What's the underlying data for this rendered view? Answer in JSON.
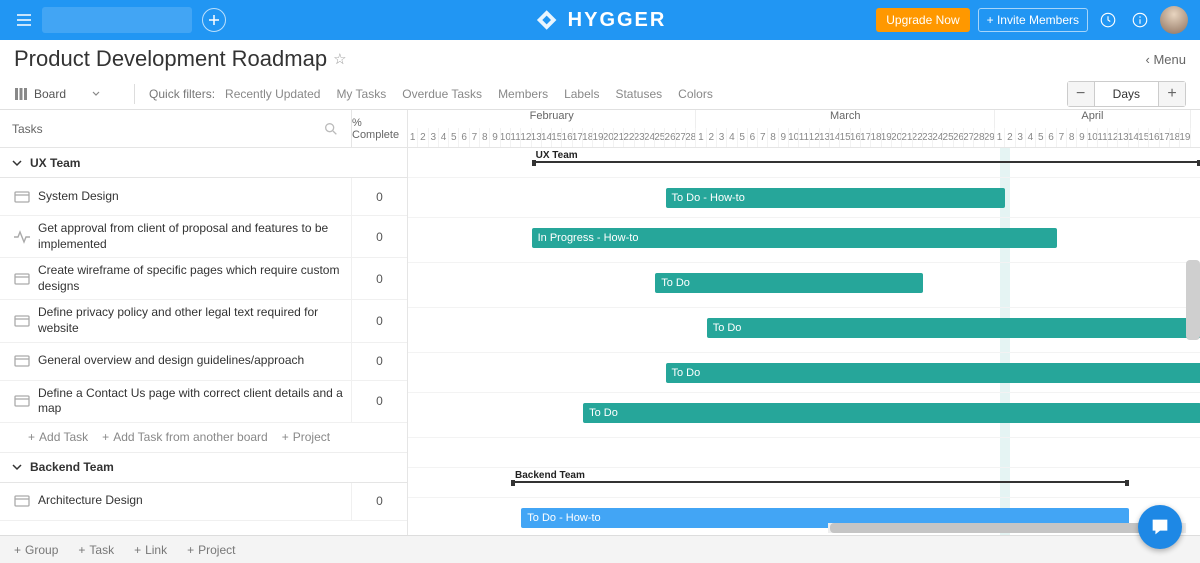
{
  "brand": "HYGGER",
  "header": {
    "upgrade": "Upgrade Now",
    "invite": "+ Invite Members"
  },
  "page": {
    "title": "Product Development Roadmap",
    "menu_link": "Menu"
  },
  "view": {
    "name": "Board"
  },
  "quick_filters_label": "Quick filters:",
  "quick_filters": [
    "Recently Updated",
    "My Tasks",
    "Overdue Tasks",
    "Members",
    "Labels",
    "Statuses",
    "Colors"
  ],
  "zoom": {
    "label": "Days"
  },
  "columns": {
    "tasks": "Tasks",
    "complete": "% Complete"
  },
  "groups": [
    {
      "name": "UX Team",
      "tasks": [
        {
          "name": "System Design",
          "complete": "0",
          "bar": {
            "label": "To Do - How-to",
            "color": "teal",
            "start": 25,
            "span": 33
          }
        },
        {
          "name": "Get approval from client of proposal and features to be implemented",
          "complete": "0",
          "activity": true,
          "bar": {
            "label": "In Progress - How-to",
            "color": "teal",
            "start": 12,
            "span": 51
          }
        },
        {
          "name": "Create wireframe of specific pages which require custom designs",
          "complete": "0",
          "bar": {
            "label": "To Do",
            "color": "teal",
            "start": 24,
            "span": 26
          }
        },
        {
          "name": "Define privacy policy and other legal text required for website",
          "complete": "0",
          "bar": {
            "label": "To Do",
            "color": "teal",
            "start": 29,
            "span": 50
          }
        },
        {
          "name": "General overview and design guidelines/approach",
          "complete": "0",
          "bar": {
            "label": "To Do",
            "color": "teal",
            "start": 25,
            "span": 54
          }
        },
        {
          "name": "Define a Contact Us page with correct client details and a map",
          "complete": "0",
          "bar": {
            "label": "To Do",
            "color": "teal",
            "start": 17,
            "span": 60
          }
        }
      ],
      "group_bar": {
        "start": 12,
        "span": 65
      }
    },
    {
      "name": "Backend Team",
      "tasks": [
        {
          "name": "Architecture Design",
          "complete": "0",
          "bar": {
            "label": "To Do - How-to",
            "color": "blue",
            "start": 11,
            "span": 59
          }
        }
      ],
      "group_bar": {
        "start": 10,
        "span": 60
      }
    }
  ],
  "add_actions": {
    "task": "Add Task",
    "from_board": "Add Task from another board",
    "project": "Project"
  },
  "bottom": {
    "group": "Group",
    "task": "Task",
    "link": "Link",
    "project": "Project"
  },
  "months": [
    {
      "name": "February",
      "days": 28,
      "start_day": 1
    },
    {
      "name": "March",
      "days": 29,
      "start_day": 1
    },
    {
      "name": "April",
      "days": 19,
      "start_day": 1
    }
  ],
  "day_width": 10.3
}
